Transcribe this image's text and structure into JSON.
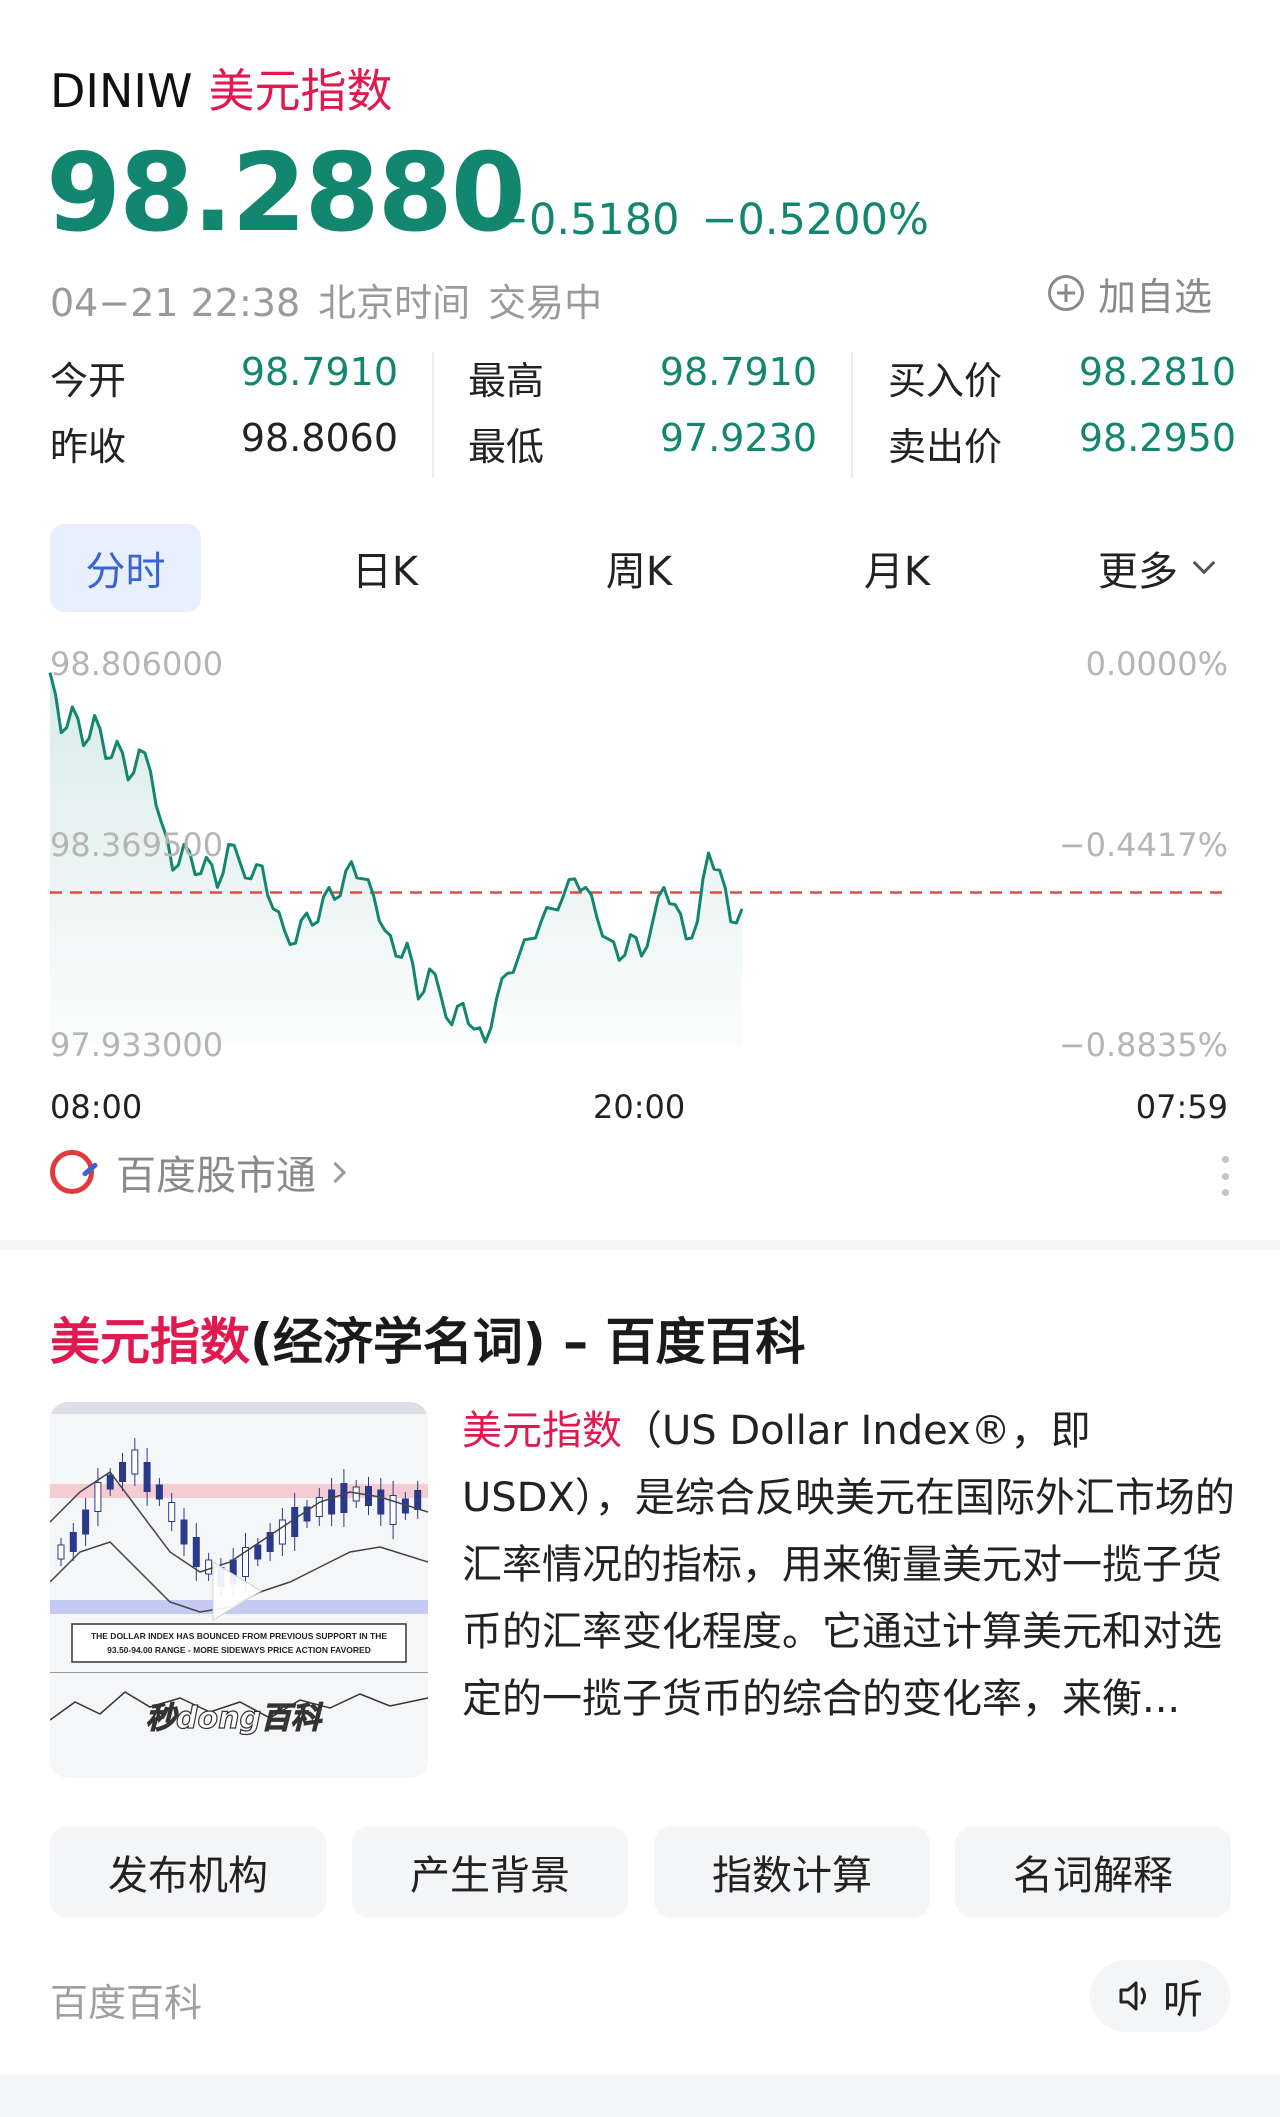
{
  "quote": {
    "symbol": "DINIW",
    "name": "美元指数",
    "price": "98.2880",
    "change": "−0.5180",
    "change_pct": "−0.5200%",
    "date_time": "04−21 22:38",
    "timezone": "北京时间",
    "status": "交易中",
    "watch_label": "加自选",
    "stats": {
      "open_label": "今开",
      "open": "98.7910",
      "prev_close_label": "昨收",
      "prev_close": "98.8060",
      "high_label": "最高",
      "high": "98.7910",
      "low_label": "最低",
      "low": "97.9230",
      "bid_label": "买入价",
      "bid": "98.2810",
      "ask_label": "卖出价",
      "ask": "98.2950"
    }
  },
  "chart_tabs": {
    "active": "分时",
    "items": [
      "分时",
      "日K",
      "周K",
      "月K"
    ],
    "more_label": "更多"
  },
  "chart_data": {
    "type": "area",
    "ylim": [
      97.933,
      98.806
    ],
    "y_labels_left": [
      "98.806000",
      "98.369500",
      "97.933000"
    ],
    "y_labels_right": [
      "0.0000%",
      "−0.4417%",
      "−0.8835%"
    ],
    "x_labels": [
      "08:00",
      "20:00",
      "07:59"
    ],
    "reference_line": 98.288,
    "reference_line_color": "#e34a4a",
    "line_color": "#13866f",
    "grid": false,
    "series": [
      {
        "values": [
          98.8,
          98.66,
          98.72,
          98.63,
          98.7,
          98.6,
          98.64,
          98.55,
          98.62,
          98.57,
          98.45,
          98.34,
          98.4,
          98.33,
          98.37,
          98.3,
          98.4,
          98.36,
          98.32,
          98.35,
          98.25,
          98.2,
          98.17,
          98.24,
          98.22,
          98.3,
          98.28,
          98.36,
          98.32,
          98.28,
          98.2,
          98.14,
          98.17,
          98.04,
          98.11,
          98.05,
          97.98,
          98.03,
          97.97,
          97.94,
          98.04,
          98.1,
          98.14,
          98.18,
          98.22,
          98.25,
          98.28,
          98.32,
          98.3,
          98.23,
          98.18,
          98.13,
          98.19,
          98.14,
          98.22,
          98.3,
          98.26,
          98.18,
          98.22,
          98.38,
          98.34,
          98.22,
          98.25
        ]
      }
    ],
    "source": "百度股市通"
  },
  "baike": {
    "title_highlight": "美元指数",
    "title_rest": "(经济学名词) – 百度百科",
    "abstract_highlight": "美元指数",
    "abstract_rest": "（US Dollar Index®，即USDX），是综合反映美元在国际外汇市场的汇率情况的指标，用来衡量美元对一揽子货币的汇率变化程度。它通过计算美元和对选定的一揽子货币的综合的变化率，来衡...",
    "thumb_banner": "THE DOLLAR INDEX HAS BOUNCED FROM PREVIOUS SUPPORT IN THE 93.50-94.00 RANGE - MORE SIDEWAYS PRICE ACTION FAVORED",
    "thumb_watermark": "秒dong百科",
    "chips": [
      "发布机构",
      "产生背景",
      "指数计算",
      "名词解释"
    ],
    "source": "百度百科",
    "listen_label": "听"
  }
}
